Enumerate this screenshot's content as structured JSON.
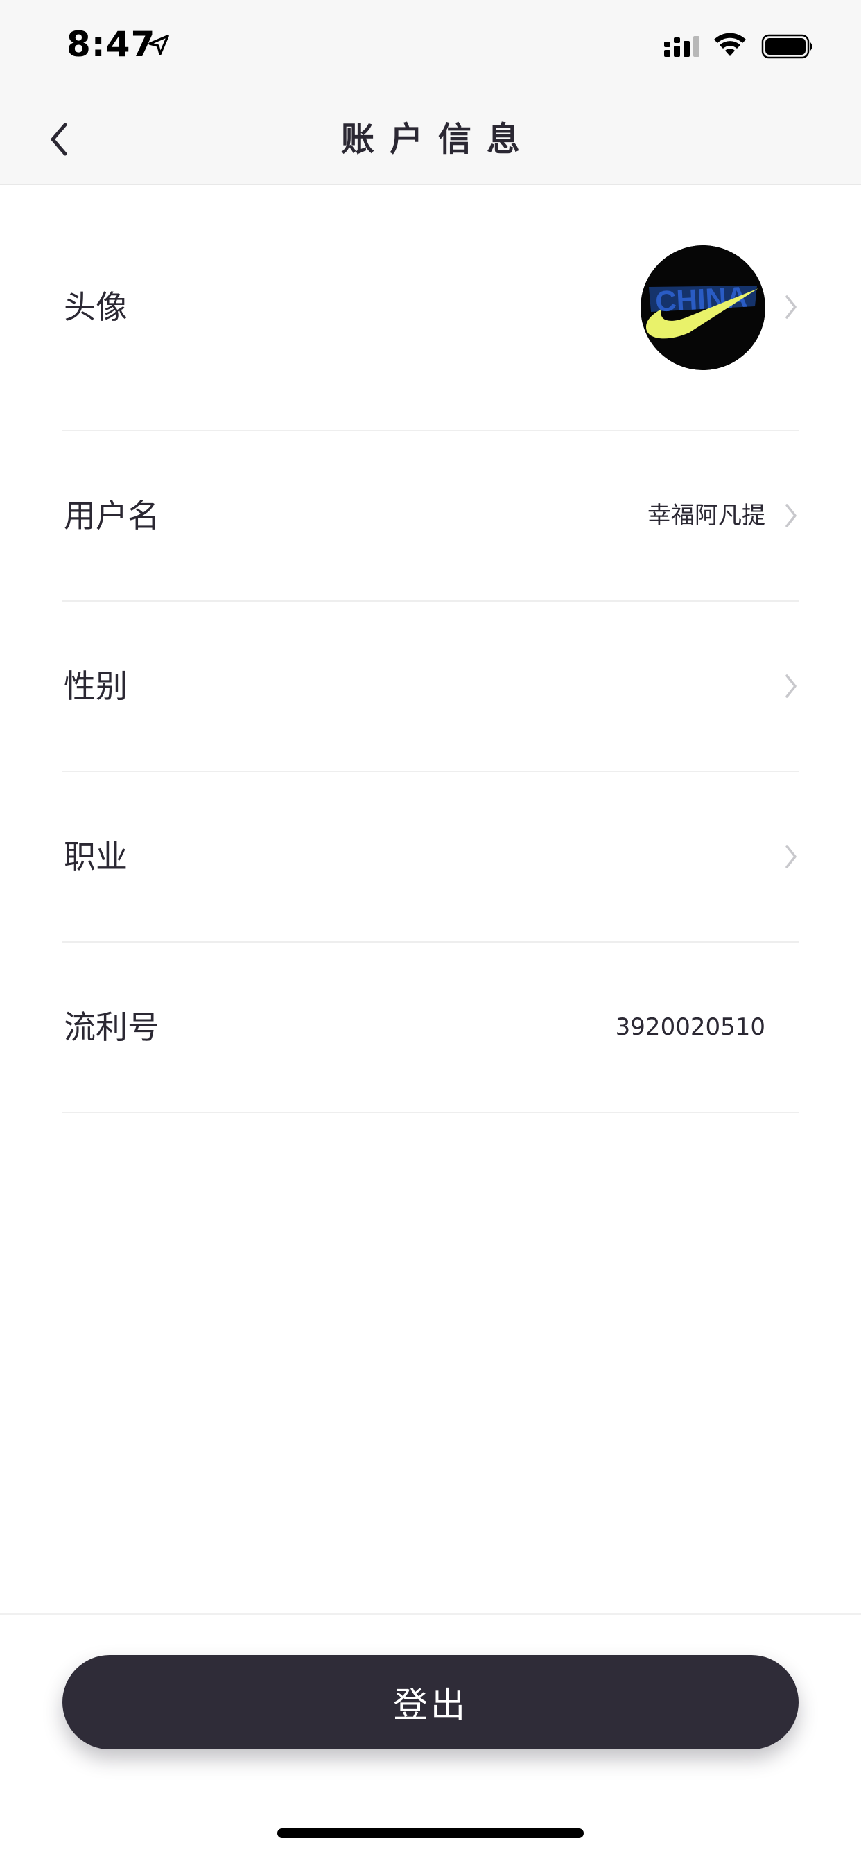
{
  "status_bar": {
    "time": "8:47",
    "icons": [
      "location-arrow-icon",
      "cellular-signal-icon",
      "wifi-icon",
      "battery-icon"
    ]
  },
  "nav": {
    "title": "账户信息",
    "back_icon": "chevron-left-icon"
  },
  "rows": [
    {
      "label": "头像",
      "value": "",
      "type": "avatar",
      "chevron": true
    },
    {
      "label": "用户名",
      "value": "幸福阿凡提",
      "chevron": true
    },
    {
      "label": "性别",
      "value": "",
      "chevron": true
    },
    {
      "label": "职业",
      "value": "",
      "chevron": true
    },
    {
      "label": "流利号",
      "value": "3920020510",
      "chevron": false
    }
  ],
  "footer": {
    "logout_label": "登出"
  },
  "colors": {
    "header_bg": "#f7f7f7",
    "text": "#2b2833",
    "button_bg": "#2f2c38",
    "chevron": "#c8c8cc",
    "avatar_accent": "#e9f26a",
    "avatar_text": "#1f3f8c"
  }
}
